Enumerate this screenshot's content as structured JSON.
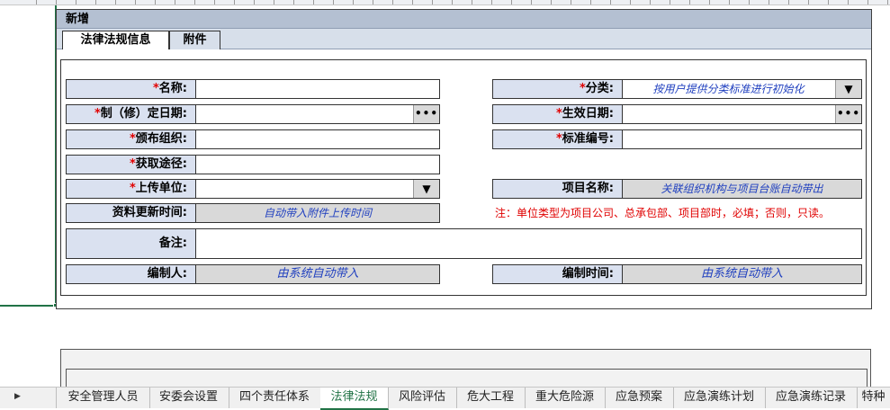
{
  "dialog": {
    "title": "新增",
    "tabs": [
      {
        "label": "法律法规信息",
        "active": true
      },
      {
        "label": "附件",
        "active": false
      }
    ]
  },
  "form": {
    "required_mark": "*",
    "name_label": "名称:",
    "category_label": "分类:",
    "category_value": "按用户提供分类标准进行初始化",
    "revision_date_label": "制（修）定日期:",
    "effective_date_label": "生效日期:",
    "issuer_label": "颁布组织:",
    "standard_no_label": "标准编号:",
    "source_label": "获取途径:",
    "upload_unit_label": "上传单位:",
    "project_name_label": "项目名称:",
    "project_name_value": "关联组织机构与项目台账自动带出",
    "update_time_label": "资料更新时间:",
    "update_time_value": "自动带入附件上传时间",
    "note_text": "注：单位类型为项目公司、总承包部、项目部时，必填；否则，只读。",
    "remark_label": "备注:",
    "author_label": "编制人:",
    "author_value": "由系统自动带入",
    "create_time_label": "编制时间:",
    "create_time_value": "由系统自动带入",
    "dropdown_glyph": "▼",
    "ellipsis_glyph": "•••"
  },
  "sheet_tabs": [
    {
      "label": "安全管理人员",
      "active": false
    },
    {
      "label": "安委会设置",
      "active": false
    },
    {
      "label": "四个责任体系",
      "active": false
    },
    {
      "label": "法律法规",
      "active": true
    },
    {
      "label": "风险评估",
      "active": false
    },
    {
      "label": "危大工程",
      "active": false
    },
    {
      "label": "重大危险源",
      "active": false
    },
    {
      "label": "应急预案",
      "active": false
    },
    {
      "label": "应急演练计划",
      "active": false
    },
    {
      "label": "应急演练记录",
      "active": false
    },
    {
      "label": "特种",
      "active": false
    }
  ],
  "sheet_nav_glyph": "▶",
  "colors": {
    "title_bar": "#b4c0d2",
    "label_bg": "#dae1f0",
    "required": "#e00000",
    "auto_text": "#1f3fbf",
    "active_sheet": "#217346"
  }
}
